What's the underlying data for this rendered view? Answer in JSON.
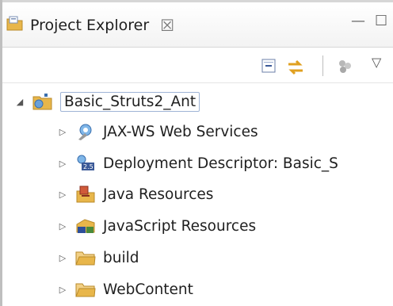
{
  "panel": {
    "title": "Project Explorer",
    "close_glyph": "☒",
    "minimize_glyph": "—",
    "maximize_glyph": "☐"
  },
  "toolbar": {
    "collapse_icon": "collapse-all-icon",
    "link_icon": "link-with-editor-icon",
    "filter_icon": "filter-icon",
    "menu_glyph": "▽"
  },
  "tree": {
    "root": {
      "label": "Basic_Struts2_Ant",
      "expanded": true,
      "icon": "web-project-icon"
    },
    "children": [
      {
        "label": "JAX-WS Web Services",
        "icon": "web-services-icon"
      },
      {
        "label": "Deployment Descriptor: Basic_S",
        "icon": "deployment-descriptor-icon"
      },
      {
        "label": "Java Resources",
        "icon": "java-resources-icon"
      },
      {
        "label": "JavaScript Resources",
        "icon": "javascript-resources-icon"
      },
      {
        "label": "build",
        "icon": "folder-icon"
      },
      {
        "label": "WebContent",
        "icon": "folder-icon"
      }
    ]
  },
  "colors": {
    "folder": "#e8b64a",
    "selection_border": "#9fb4d6",
    "link_icon": "#e0a020"
  }
}
